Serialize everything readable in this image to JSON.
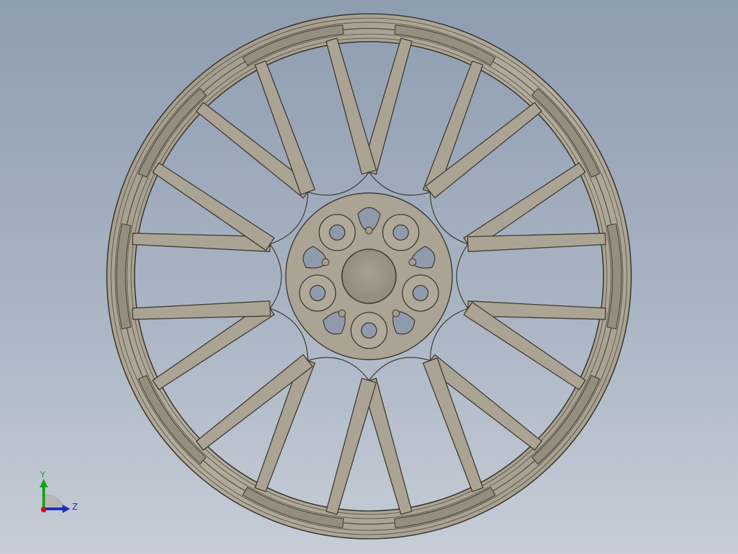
{
  "viewport": {
    "background_top": "#8f9db1",
    "background_bottom": "#c6cdd7",
    "model": {
      "name": "wheel-rim",
      "spoke_pairs": 10,
      "lug_holes": 5,
      "color": "#aba393",
      "edge_color": "#3c382f"
    },
    "triad": {
      "y_label": "Y",
      "z_label": "Z",
      "y_color": "#1aa11a",
      "z_color": "#1a2fc0",
      "x_color": "#c01a1a"
    }
  }
}
